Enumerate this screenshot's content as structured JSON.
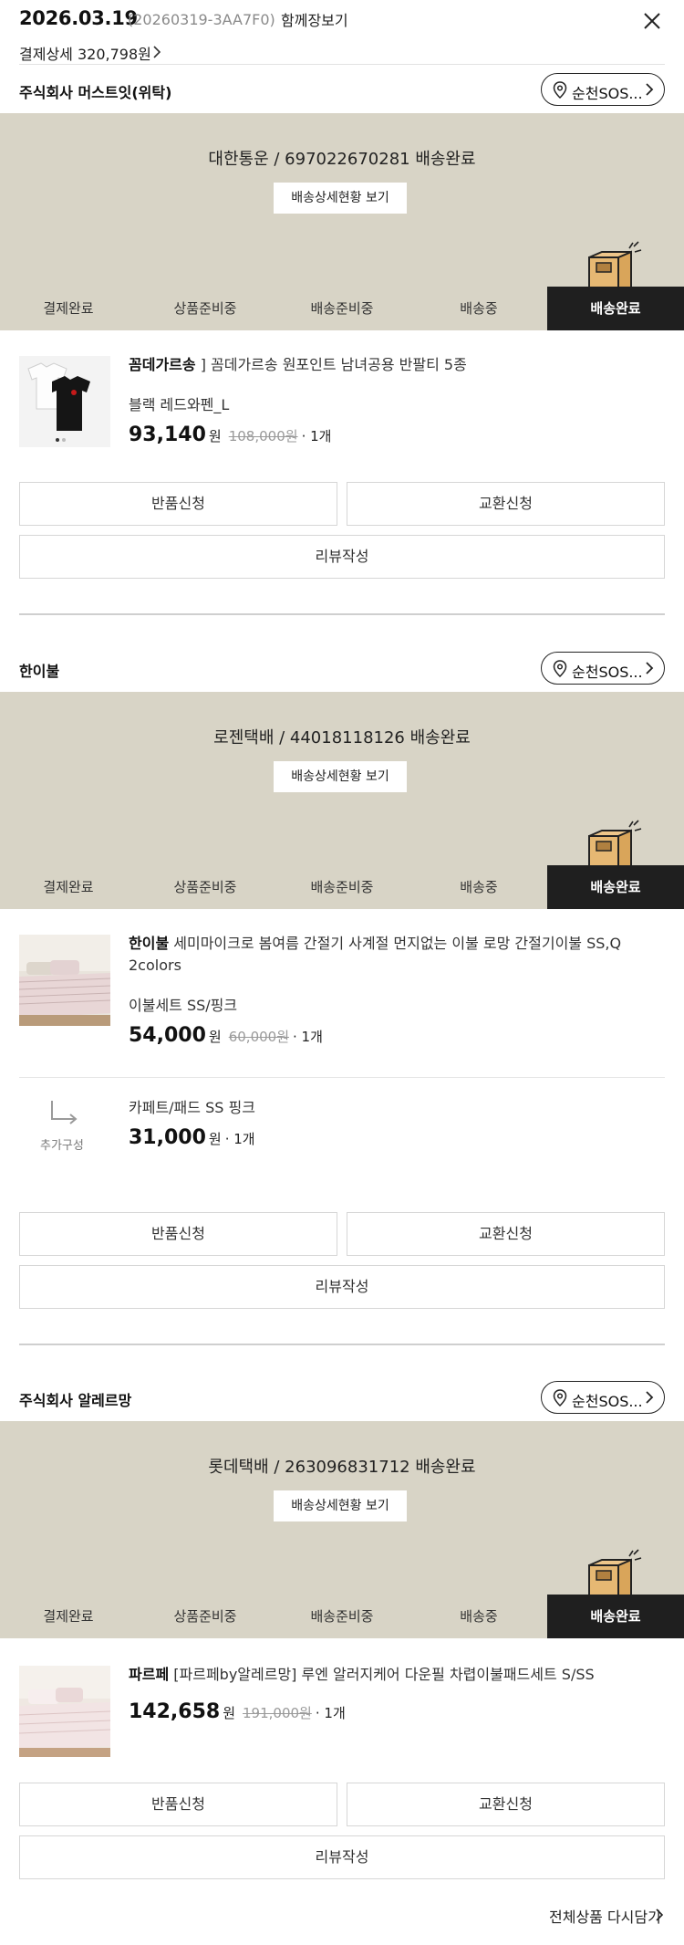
{
  "header": {
    "date": "2026.03.19",
    "order_code": "(20260319-3AA7F0)",
    "together_label": "함께장보기",
    "payment_label": "결제상세 320,798원"
  },
  "steps": [
    "결제완료",
    "상품준비중",
    "배송준비중",
    "배송중",
    "배송완료"
  ],
  "panel_button": "배송상세현황 보기",
  "action_buttons": {
    "return": "반품신청",
    "exchange": "교환신청",
    "review": "리뷰작성"
  },
  "addon_label": "추가구성",
  "sellers": [
    {
      "name": "주식회사 머스트잇(위탁)",
      "location": "순천SOS...",
      "carrier": "대한통운 / 697022670281 배송완료",
      "products": [
        {
          "brand": "꼼데가르송",
          "title": " ] 꼼데가르송 원포인트 남녀공용 반팔티 5종",
          "option": "블랙 레드와펜_L",
          "price": "93,140",
          "won": "원",
          "original": "108,000원",
          "qty": "· 1개"
        }
      ]
    },
    {
      "name": "한이불",
      "location": "순천SOS...",
      "carrier": "로젠택배 / 44018118126 배송완료",
      "products": [
        {
          "brand": "한이불",
          "title": " 세미마이크로 봄여름 간절기 사계절 먼지없는 이불 로망 간절기이불 SS,Q 2colors",
          "option": "이불세트 SS/핑크",
          "price": "54,000",
          "won": "원",
          "original": "60,000원",
          "qty": "· 1개"
        }
      ],
      "addon": {
        "title": "카페트/패드 SS 핑크",
        "price": "31,000",
        "won": "원",
        "qty": "· 1개"
      }
    },
    {
      "name": "주식회사 알레르망",
      "location": "순천SOS...",
      "carrier": "롯데택배 / 263096831712 배송완료",
      "products": [
        {
          "brand": "파르페",
          "title": " [파르페by알레르망] 루엔 알러지케어 다운필 차렵이불패드세트 S/SS",
          "option": "",
          "price": "142,658",
          "won": "원",
          "original": "191,000원",
          "qty": "· 1개"
        }
      ]
    }
  ],
  "footer": {
    "reorder_label": "전체상품 다시담기"
  }
}
